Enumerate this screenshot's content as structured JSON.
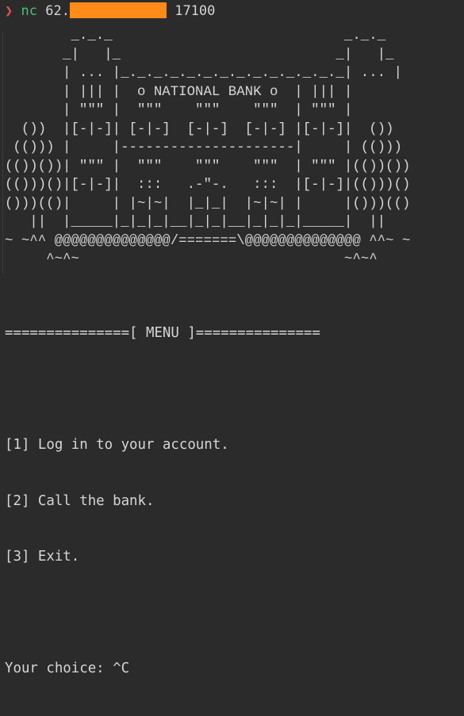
{
  "prompt": {
    "arrow": "❯",
    "command": "nc",
    "host_prefix": "62.",
    "port": "17100"
  },
  "banner_lines": [
    "        _._._                            _._._",
    "       _|   |_                          _|   |_",
    "       | ... |_._._._._._._._._._._._._._| ... |",
    "       | ||| |  o NATIONAL BANK o  | ||| |",
    "       | \"\"\" |  \"\"\"    \"\"\"    \"\"\"  | \"\"\" |",
    "  ())  |[-|-]| [-|-]  [-|-]  [-|-] |[-|-]|  ())",
    " (())) |     |---------------------|     | (()))",
    "(())())| \"\"\" |  \"\"\"    \"\"\"    \"\"\"  | \"\"\" |(())())",
    "(()))()|[-|-]|  :::   .-\"-.   :::  |[-|-]|(()))()",
    "()))(()|     | |~|~|  |_|_|  |~|~| |     |()))(()",
    "   ||  |_____|_|_|_|__|_|_|__|_|_|_|_____|  ||",
    "~ ~^^ @@@@@@@@@@@@@@/=======\\@@@@@@@@@@@@@@ ^^~ ~",
    "     ^~^~                                ~^~^"
  ],
  "menu": {
    "title_line": "===============[ MENU ]===============",
    "items": [
      "[1] Log in to your account.",
      "[2] Call the bank.",
      "[3] Exit."
    ],
    "choice_prompt": "Your choice: ^C"
  },
  "colors": {
    "background": "#2b2b2b",
    "text": "#d6d6d6",
    "prompt_arrow": "#e05252",
    "prompt_command": "#49c07a",
    "redaction": "#ff8c1a"
  }
}
